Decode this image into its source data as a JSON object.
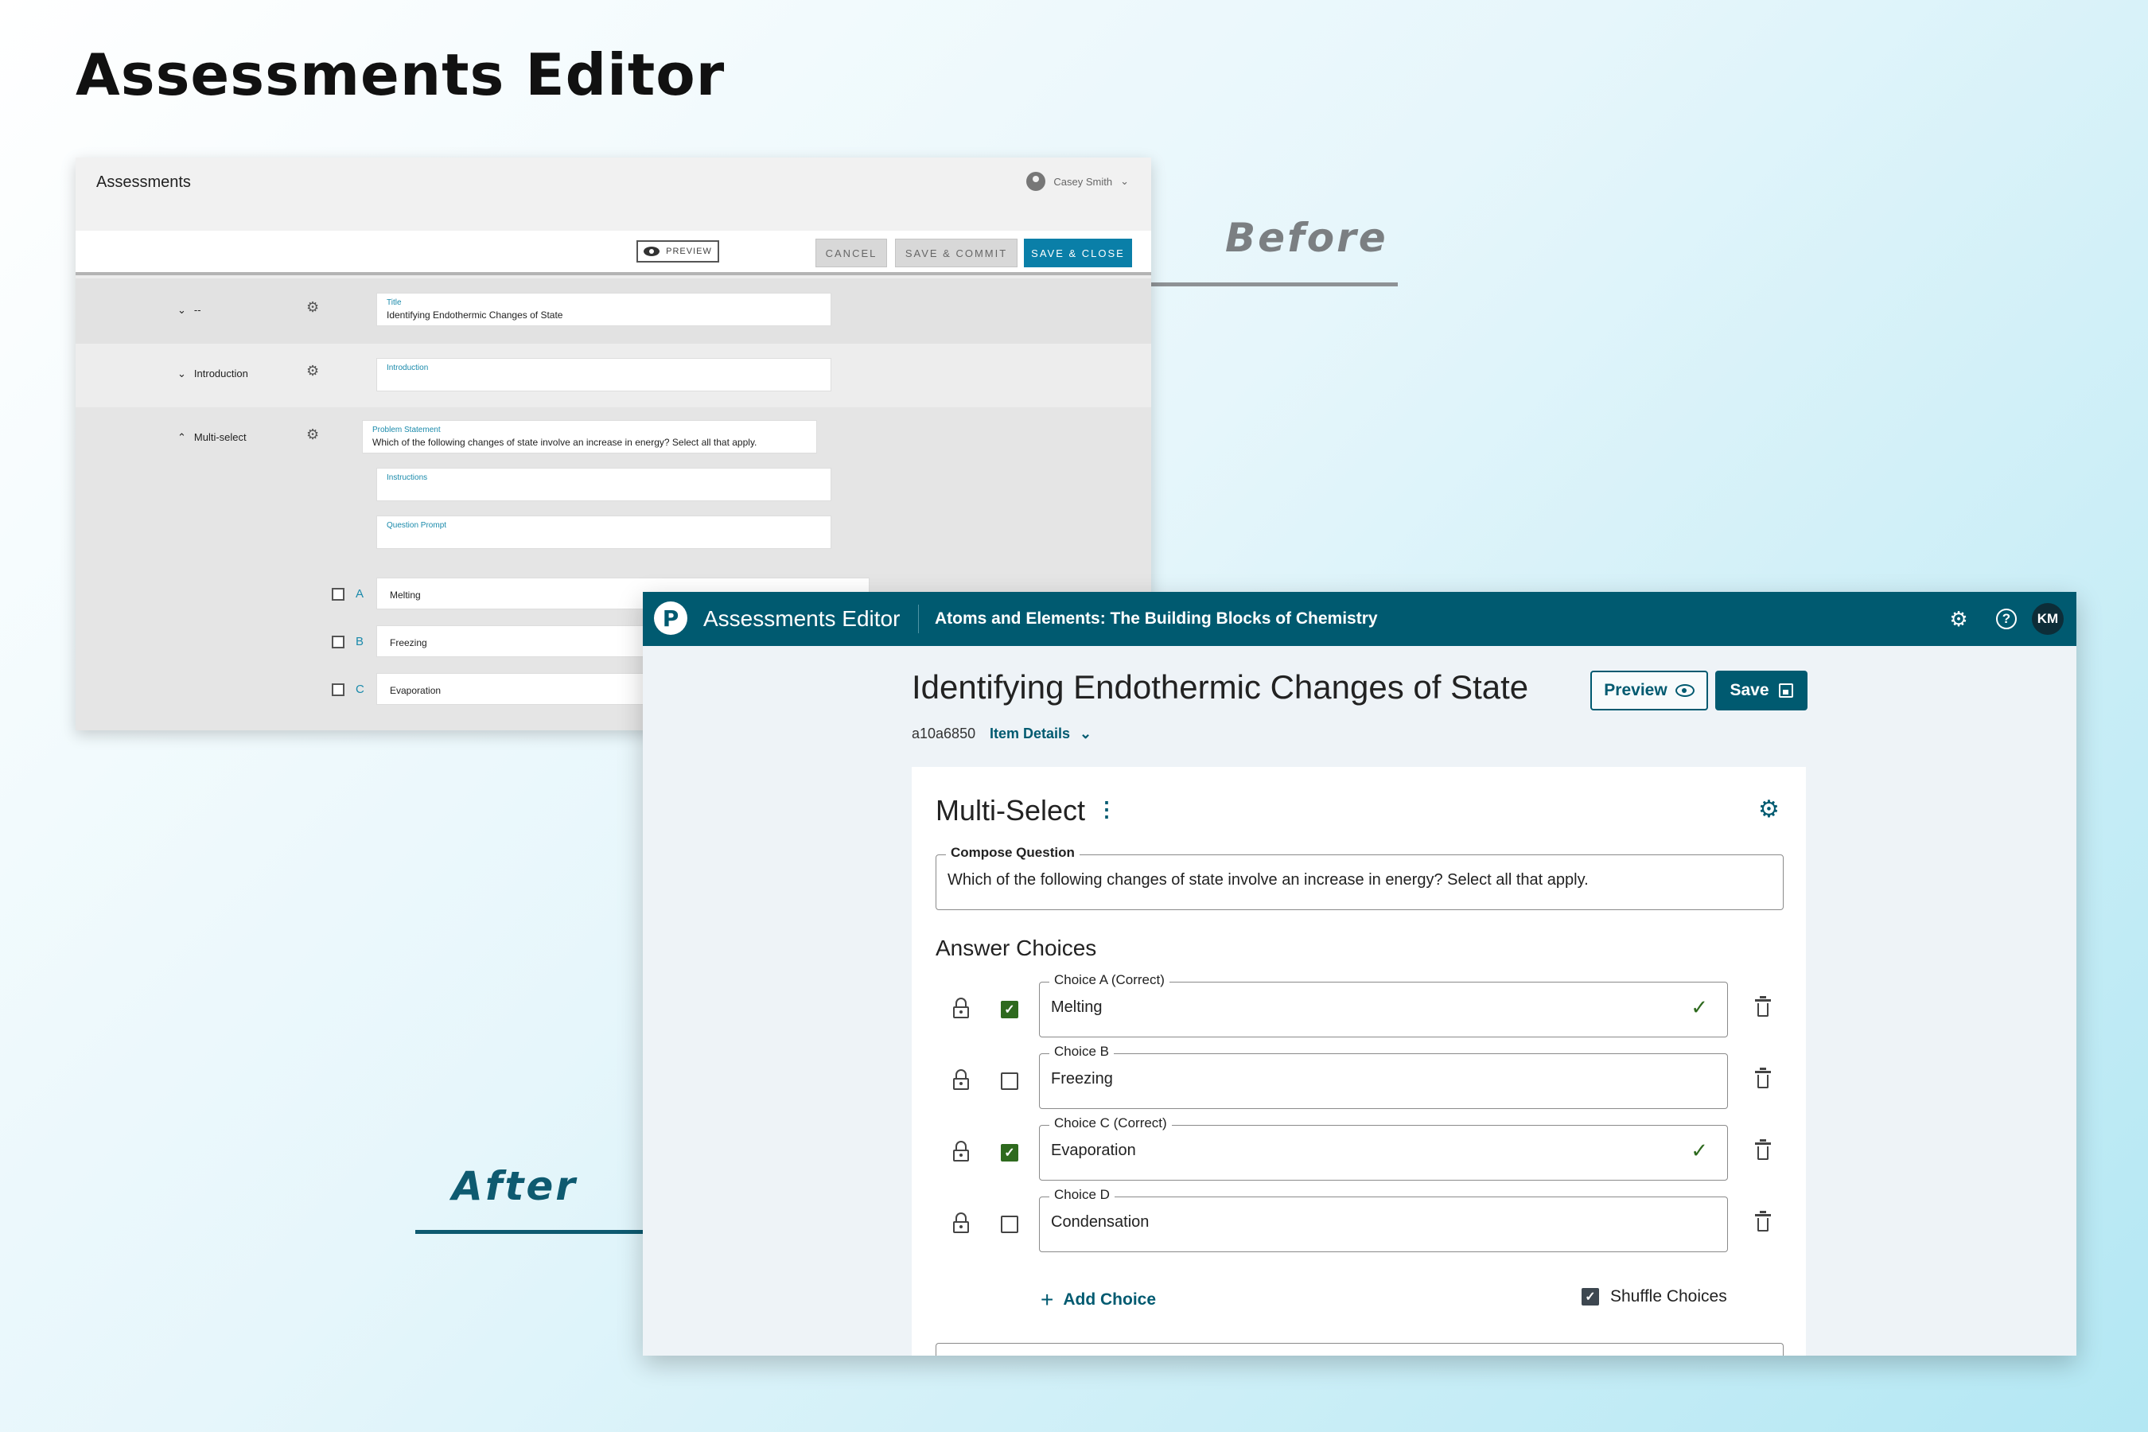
{
  "page": {
    "title": "Assessments Editor",
    "before_tag": "Before",
    "after_tag": "After"
  },
  "before": {
    "header_title": "Assessments",
    "user_name": "Casey Smith",
    "toolbar": {
      "preview": "PREVIEW",
      "cancel": "CANCEL",
      "save_commit": "SAVE & COMMIT",
      "save_close": "SAVE & CLOSE"
    },
    "sections": [
      {
        "label": "--",
        "field_label": "Title",
        "field_value": "Identifying Endothermic Changes of State"
      },
      {
        "label": "Introduction",
        "field_label": "Introduction",
        "field_value": ""
      },
      {
        "label": "Multi-select",
        "field_label": "Problem Statement",
        "field_value": "Which of the following changes of state involve an increase in energy? Select all that apply."
      }
    ],
    "extra_fields": [
      "Instructions",
      "Question Prompt"
    ],
    "choices": [
      {
        "letter": "A",
        "value": "Melting"
      },
      {
        "letter": "B",
        "value": "Freezing"
      },
      {
        "letter": "C",
        "value": "Evaporation"
      }
    ]
  },
  "after": {
    "app_name": "Assessments Editor",
    "course_title": "Atoms and Elements: The Building Blocks of Chemistry",
    "avatar_initials": "KM",
    "logo_letter": "P",
    "item_title": "Identifying Endothermic Changes of State",
    "item_id": "a10a6850",
    "item_details": "Item Details",
    "preview_label": "Preview",
    "save_label": "Save",
    "question_type": "Multi-Select",
    "compose_label": "Compose Question",
    "compose_value": "Which of the following changes of state involve an increase in energy? Select all that apply.",
    "answer_section": "Answer Choices",
    "choices": [
      {
        "label": "Choice A (Correct)",
        "value": "Melting",
        "correct": true
      },
      {
        "label": "Choice B",
        "value": "Freezing",
        "correct": false
      },
      {
        "label": "Choice C (Correct)",
        "value": "Evaporation",
        "correct": true
      },
      {
        "label": "Choice D",
        "value": "Condensation",
        "correct": false
      }
    ],
    "add_choice": "Add Choice",
    "shuffle_choices": "Shuffle Choices",
    "shuffle_checked": true,
    "accent_color": "#005a70",
    "correct_color": "#2e6a1e"
  }
}
